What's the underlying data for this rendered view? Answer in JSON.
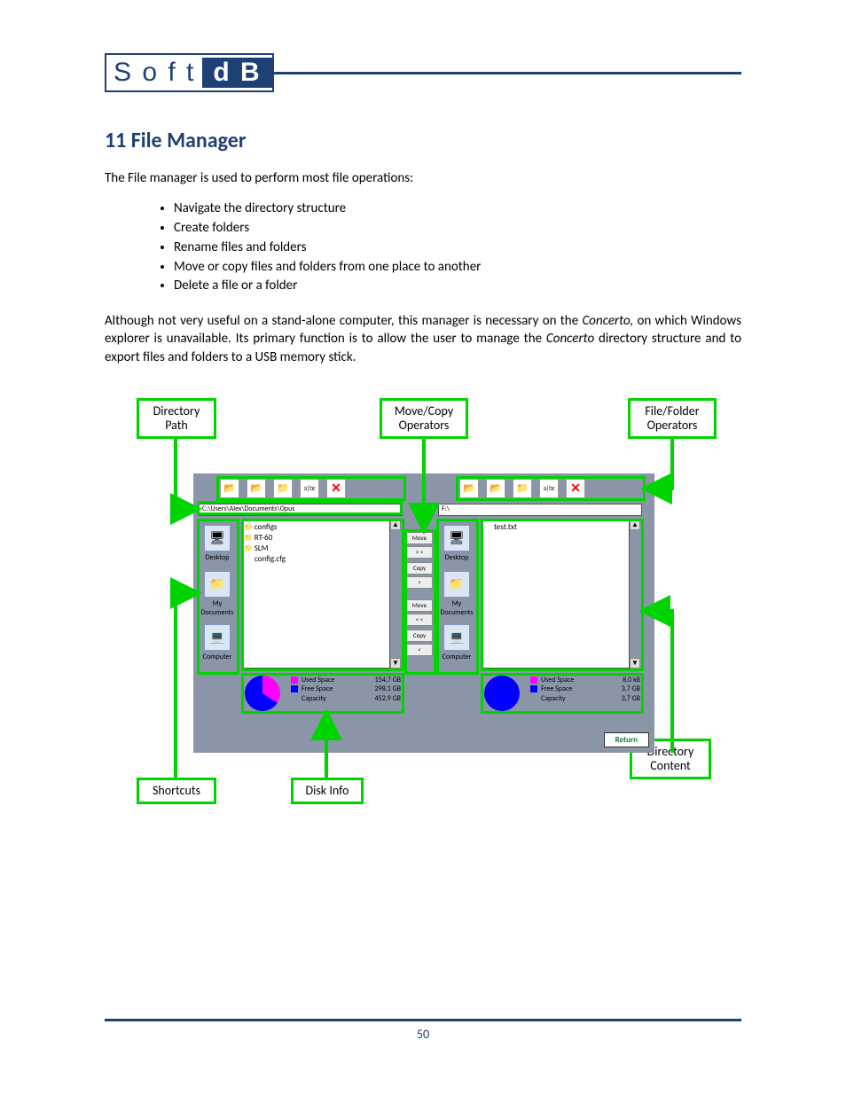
{
  "logo": {
    "left": "S o f t",
    "right": "d B"
  },
  "heading": "11   File Manager",
  "intro": "The File manager is used to perform most file operations:",
  "bullets": [
    "Navigate the directory structure",
    "Create folders",
    "Rename files and folders",
    "Move or copy files and folders from one place to another",
    "Delete a file or a folder"
  ],
  "para_before_em1": "Although not very useful on a stand-alone computer, this manager is necessary on the ",
  "para_em1": "Concerto,",
  "para_mid": " on which Windows explorer is unavailable. Its primary function is to allow the user to manage the ",
  "para_em2": "Concerto",
  "para_after": " directory structure and to export files and folders to a USB memory stick.",
  "callouts": {
    "dir_path": "Directory\nPath",
    "move_copy": "Move/Copy\nOperators",
    "file_folder": "File/Folder\nOperators",
    "shortcuts": "Shortcuts",
    "disk_info": "Disk Info",
    "dir_content": "Directory\nContent"
  },
  "left_pane": {
    "path": "C:\\Users\\Alex\\Documents\\Opus",
    "files": [
      "configs",
      "RT-60",
      "SLM",
      "config.cfg"
    ],
    "disk": {
      "used_label": "Used Space",
      "free_label": "Free Space",
      "cap_label": "Capacity",
      "used_val": "154,7 GB",
      "free_val": "298,1 GB",
      "cap_val": "452,9 GB"
    }
  },
  "right_pane": {
    "path": "F:\\",
    "files": [
      "test.txt"
    ],
    "disk": {
      "used_label": "Used Space",
      "free_label": "Free Space",
      "cap_label": "Capacity",
      "used_val": "8,0 kB",
      "free_val": "3,7 GB",
      "cap_val": "3,7 GB"
    }
  },
  "shortcuts": [
    "Desktop",
    "My\nDocuments",
    "Computer"
  ],
  "ops": [
    "Move",
    "> >",
    "Copy",
    ">",
    "Move",
    "< <",
    "Copy",
    "<"
  ],
  "toolbar_abc": "a|bc",
  "return": "Return",
  "page_number": "50"
}
